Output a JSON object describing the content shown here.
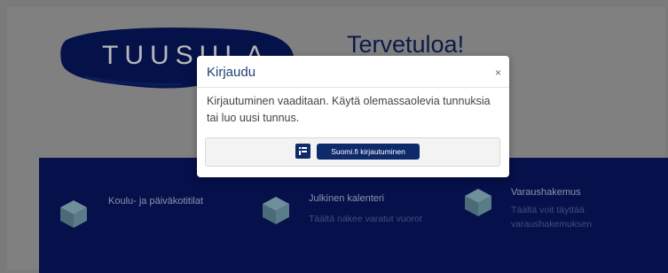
{
  "header": {
    "logo_text": "TUUSULA",
    "welcome": "Tervetuloa!"
  },
  "features": [
    {
      "title": "Koulu- ja päiväkotitilat",
      "subtitle": ""
    },
    {
      "title": "Julkinen kalenteri",
      "subtitle": "Täältä näkee varatut vuorot"
    },
    {
      "title": "Varaushakemus",
      "subtitle": "Täältä voit täyttää varaushakemuksen"
    }
  ],
  "modal": {
    "title": "Kirjaudu",
    "close_label": "×",
    "body": "Kirjautuminen vaaditaan. Käytä olemassaolevia tunnuksia tai luo uusi tunnus.",
    "button_label": "Suomi.fi kirjautuminen"
  },
  "colors": {
    "brand_navy": "#0d2a6b",
    "band_navy": "#06104a",
    "overlay_gray": "#808080"
  }
}
